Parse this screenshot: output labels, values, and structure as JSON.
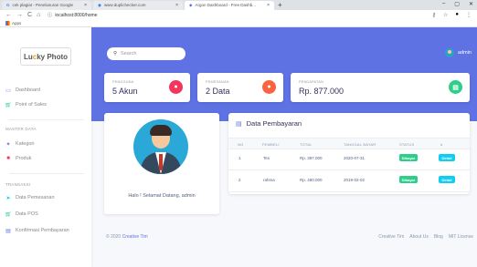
{
  "browser": {
    "tabs": [
      {
        "label": "cek plagiat - Penelusuran Google",
        "active": false
      },
      {
        "label": "www.duplichecker.com",
        "active": false
      },
      {
        "label": "Argon Dashboard - Free Dashb...",
        "active": true
      }
    ],
    "url": "localhost:8000/home",
    "bookmark_apps": "Apps"
  },
  "sidebar": {
    "logo_left": "Lu",
    "logo_accent": "c",
    "logo_right": "ky Photo",
    "items_top": [
      {
        "label": "Dashboard",
        "icon": "tv-icon",
        "color": "#5e72e4"
      },
      {
        "label": "Point of Sales",
        "icon": "cart-icon",
        "color": "#2dce89"
      }
    ],
    "master_heading": "MASTER DATA",
    "master_items": [
      {
        "label": "Kategori",
        "icon": "planet-icon",
        "color": "#5e72e4"
      },
      {
        "label": "Produk",
        "icon": "box-icon",
        "color": "#f5365c"
      }
    ],
    "transaksi_heading": "TRANSAKSI",
    "transaksi_items": [
      {
        "label": "Data Pemesanan",
        "icon": "send-icon",
        "color": "#11cdef"
      },
      {
        "label": "Data POS",
        "icon": "cart-icon",
        "color": "#2dce89"
      },
      {
        "label": "Konfirmasi Pembayaran",
        "icon": "money-icon",
        "color": "#5e72e4"
      }
    ]
  },
  "header": {
    "search_placeholder": "Search",
    "admin_name": "admin"
  },
  "stats": [
    {
      "label": "PENGGUNA",
      "value": "5 Akun",
      "color": "#f5365c",
      "icon": "user-icon"
    },
    {
      "label": "PEMESANAN",
      "value": "2 Data",
      "color": "#fb6340",
      "icon": "cart-icon"
    },
    {
      "label": "PENDAPATAN",
      "value": "Rp. 877.000",
      "color": "#2dce89",
      "icon": "money-icon"
    }
  ],
  "profile": {
    "greeting": "Halo ! Selamat Datang, admin"
  },
  "payments": {
    "title": "Data Pembayaran",
    "columns": [
      "NO",
      "PEMBELI",
      "TOTAL",
      "TANGGAL BAYAR",
      "STATUS",
      "#"
    ],
    "rows": [
      {
        "no": "1",
        "buyer": "Tes",
        "total": "Rp. 397.000",
        "date": "2020-07-31",
        "status": "Dibayar",
        "action": "Detail"
      },
      {
        "no": "2",
        "buyer": "rahma",
        "total": "Rp. 480.000",
        "date": "2019-02-02",
        "status": "Dibayar",
        "action": "Detail"
      }
    ]
  },
  "footer": {
    "copyright": "© 2020",
    "brand": "Creative Tim",
    "links": [
      "Creative Tim",
      "About Us",
      "Blog",
      "MIT License"
    ]
  }
}
